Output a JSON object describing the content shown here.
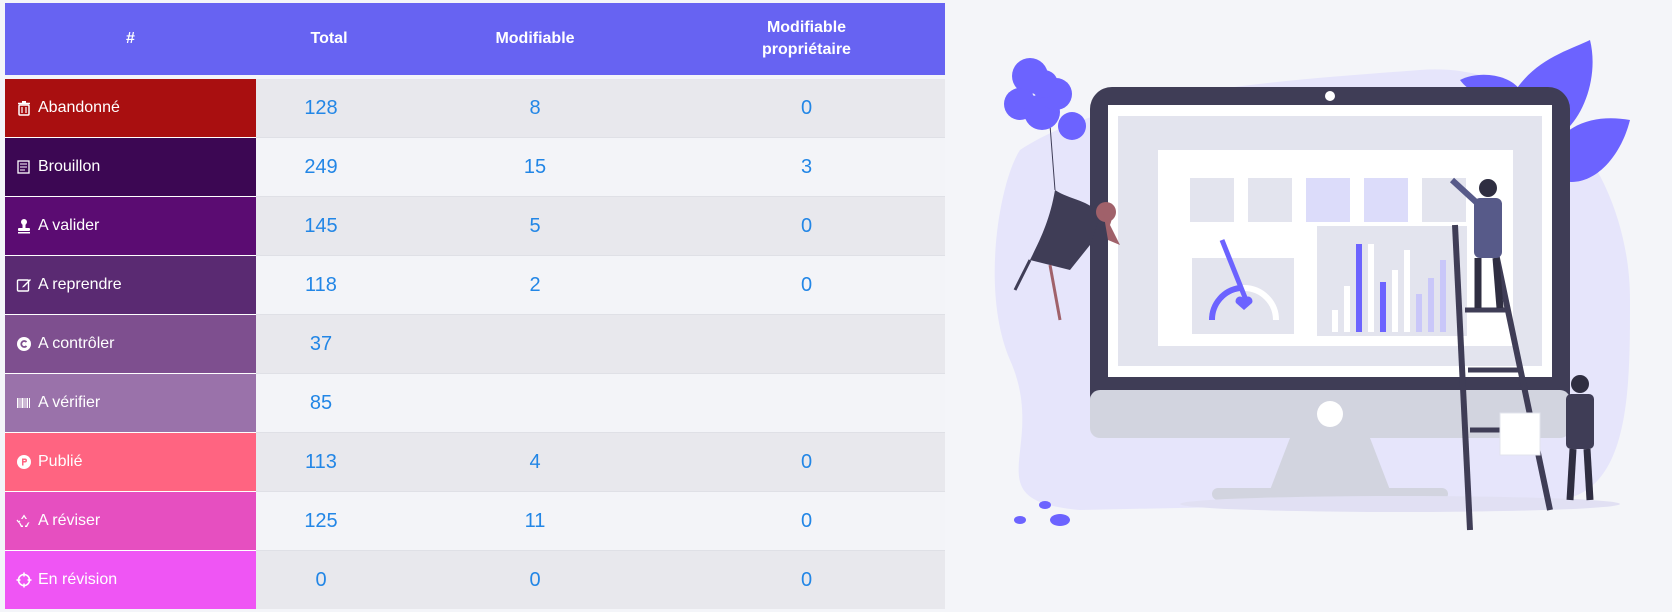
{
  "table": {
    "headers": {
      "hash": "#",
      "total": "Total",
      "modifiable": "Modifiable",
      "modifiable_owner_line1": "Modifiable",
      "modifiable_owner_line2": "propriétaire"
    },
    "rows": [
      {
        "label": "Abandonné",
        "icon": "trash-icon",
        "color": "#a90f10",
        "total": "128",
        "modifiable": "8",
        "owner": "0"
      },
      {
        "label": "Brouillon",
        "icon": "draft-icon",
        "color": "#3c0753",
        "total": "249",
        "modifiable": "15",
        "owner": "3"
      },
      {
        "label": "A valider",
        "icon": "stamp-icon",
        "color": "#5b0c72",
        "total": "145",
        "modifiable": "5",
        "owner": "0"
      },
      {
        "label": "A reprendre",
        "icon": "edit-icon",
        "color": "#5a2a72",
        "total": "118",
        "modifiable": "2",
        "owner": "0"
      },
      {
        "label": "A contrôler",
        "icon": "copyright-icon",
        "color": "#7e4f8f",
        "total": "37",
        "modifiable": "",
        "owner": ""
      },
      {
        "label": "A vérifier",
        "icon": "barcode-icon",
        "color": "#9a72aa",
        "total": "85",
        "modifiable": "",
        "owner": ""
      },
      {
        "label": "Publié",
        "icon": "product-hunt-icon",
        "color": "#ff6481",
        "total": "113",
        "modifiable": "4",
        "owner": "0"
      },
      {
        "label": "A réviser",
        "icon": "recycle-icon",
        "color": "#e64fc0",
        "total": "125",
        "modifiable": "11",
        "owner": "0"
      },
      {
        "label": "En révision",
        "icon": "crosshairs-icon",
        "color": "#ef55f4",
        "total": "0",
        "modifiable": "0",
        "owner": "0"
      }
    ]
  },
  "colors": {
    "header_bg": "#6763f2",
    "number_text": "#2286e6",
    "illustration_accent": "#6c63ff",
    "page_bg": "#f4f5f9"
  }
}
